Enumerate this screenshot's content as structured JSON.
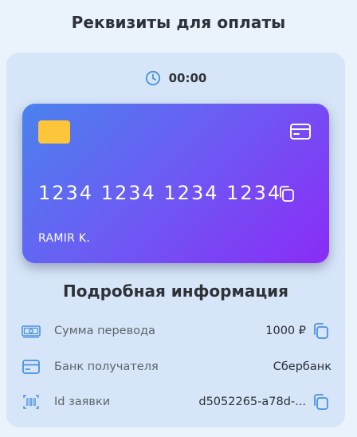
{
  "header": {
    "title": "Реквизиты для оплаты"
  },
  "timer": {
    "icon": "clock-icon",
    "value": "00:00"
  },
  "card": {
    "number": "1234 1234 1234 1234",
    "holder": "RAMIR K.",
    "gradient_colors": [
      "#4a82ee",
      "#8a2cf6"
    ],
    "chip_color": "#fdc63a",
    "type_icon": "credit-card-icon",
    "copy_icon": "copy-icon"
  },
  "details": {
    "title": "Подробная информация",
    "rows": [
      {
        "icon": "banknote-icon",
        "label": "Сумма перевода",
        "value": "1000 ₽",
        "copyable": true
      },
      {
        "icon": "credit-card-icon",
        "label": "Банк получателя",
        "value": "Сбербанк",
        "copyable": false
      },
      {
        "icon": "barcode-icon",
        "label": "Id заявки",
        "value": "d5052265-a78d-...",
        "copyable": true
      }
    ]
  },
  "colors": {
    "accent": "#4a90e2",
    "panel": "#d6e6f8",
    "background": "#eaf2fb"
  }
}
